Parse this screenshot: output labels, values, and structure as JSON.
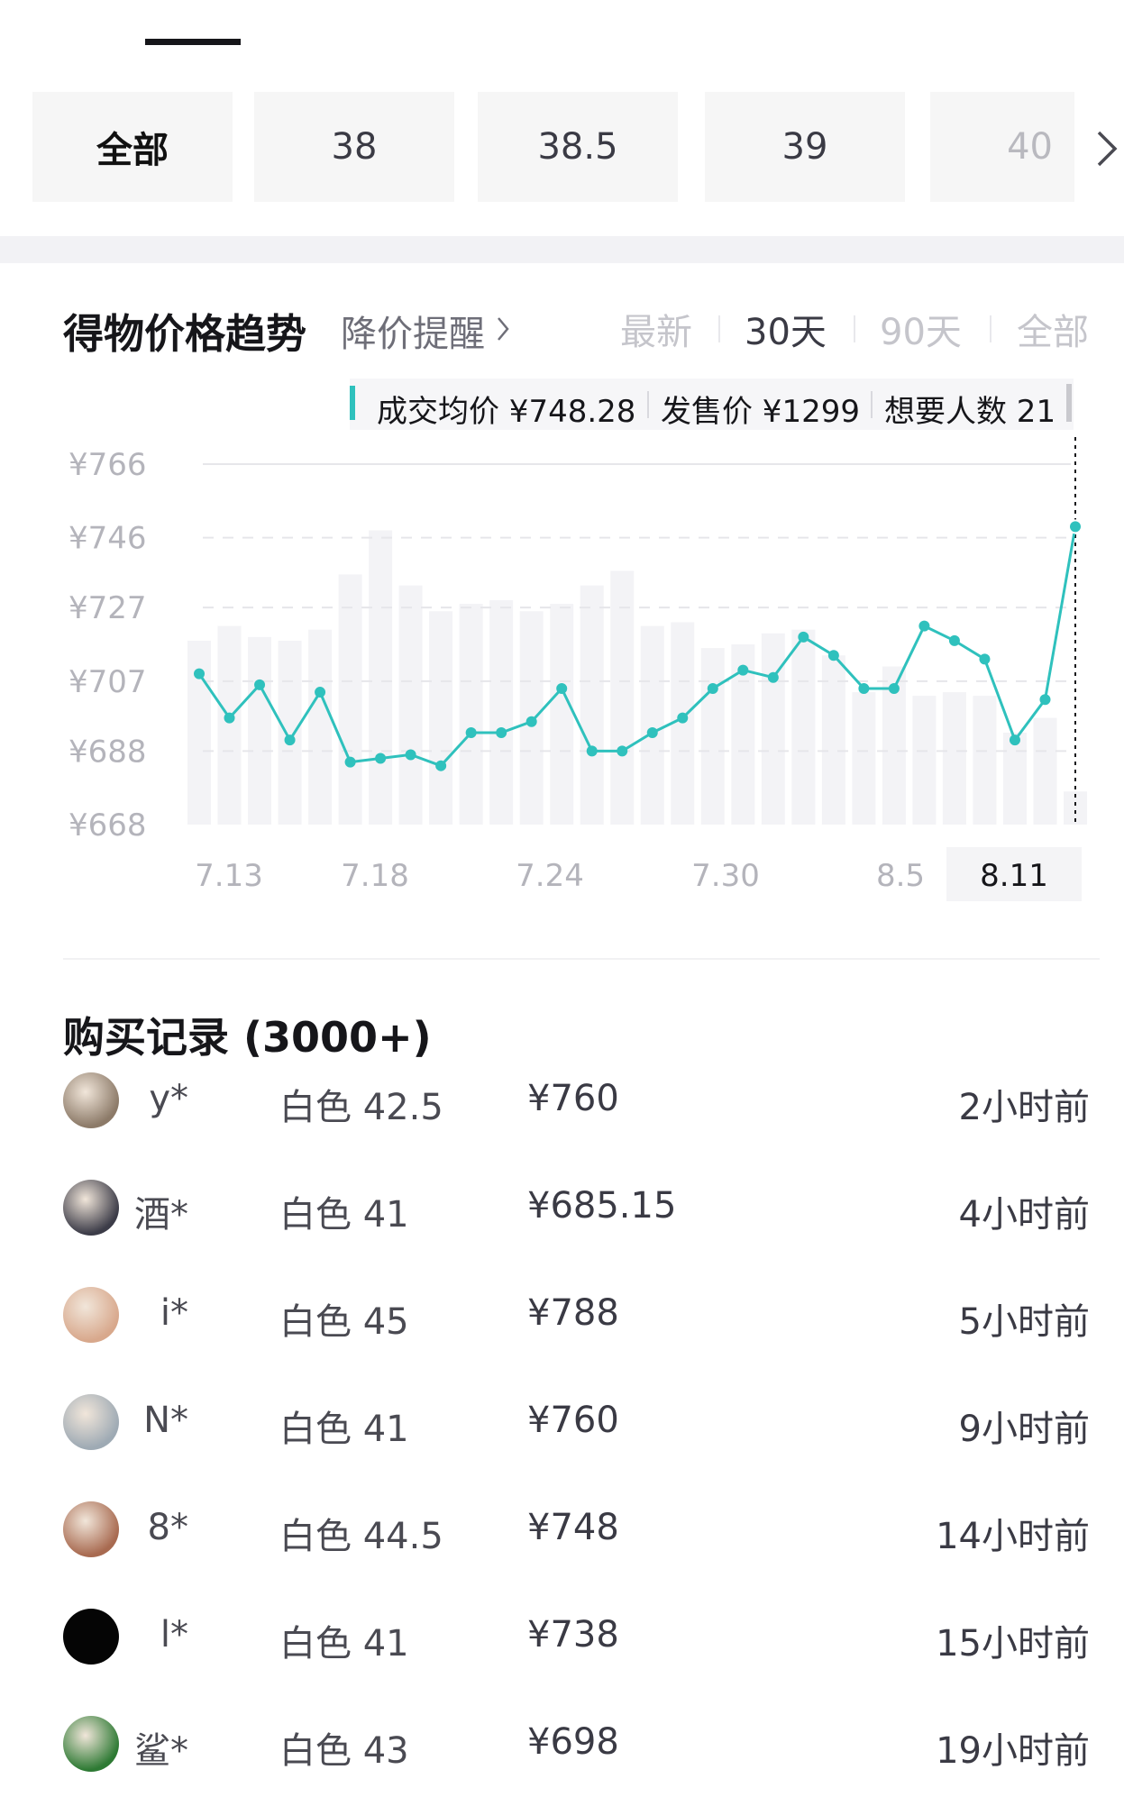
{
  "size_filter": {
    "options": [
      "全部",
      "38",
      "38.5",
      "39",
      "40"
    ],
    "selected": "全部",
    "next_icon": "chevron-right-icon"
  },
  "price_trend": {
    "title": "得物价格趋势",
    "alert_label": "降价提醒",
    "alert_icon": "chevron-right-icon",
    "ranges": [
      "最新",
      "30天",
      "90天",
      "全部"
    ],
    "selected_range": "30天",
    "tooltip": {
      "avg_price": "成交均价 ¥748.28",
      "retail_price": "发售价 ¥1299",
      "wants": "想要人数 21"
    },
    "accent_color": "#2fc1bd"
  },
  "chart_data": {
    "type": "line",
    "y_tick_labels": [
      "¥766",
      "¥746",
      "¥727",
      "¥707",
      "¥688",
      "¥668"
    ],
    "y_ticks": [
      766,
      746,
      727,
      707,
      688,
      668
    ],
    "ylim": [
      668,
      766
    ],
    "x_tick_labels": [
      "7.13",
      "7.18",
      "7.24",
      "7.30",
      "8.5",
      "8.11"
    ],
    "highlighted_x_label": "8.11",
    "grid": true,
    "series": [
      {
        "type": "line",
        "values": [
          709,
          697,
          706,
          691,
          704,
          685,
          686,
          687,
          684,
          693,
          693,
          696,
          705,
          688,
          688,
          693,
          697,
          705,
          710,
          708,
          719,
          714,
          705,
          705,
          722,
          718,
          713,
          691,
          702,
          749
        ]
      },
      {
        "type": "bar",
        "values": [
          718,
          722,
          719,
          718,
          721,
          736,
          748,
          733,
          726,
          728,
          729,
          726,
          728,
          733,
          737,
          722,
          723,
          716,
          717,
          720,
          721,
          714,
          704,
          711,
          703,
          704,
          703,
          693,
          697,
          677
        ]
      }
    ]
  },
  "records": {
    "title": "购买记录 (3000+)",
    "rows": [
      {
        "user": "y*",
        "size": "白色 42.5",
        "price": "¥760",
        "time": "2小时前",
        "avatar": "#8c7a68"
      },
      {
        "user": "酒*",
        "size": "白色 41",
        "price": "¥685.15",
        "time": "4小时前",
        "avatar": "#3c3c48"
      },
      {
        "user": "i*",
        "size": "白色 45",
        "price": "¥788",
        "time": "5小时前",
        "avatar": "#d8a88c"
      },
      {
        "user": "N*",
        "size": "白色 41",
        "price": "¥760",
        "time": "9小时前",
        "avatar": "#9eaab4"
      },
      {
        "user": "8*",
        "size": "白色 44.5",
        "price": "¥748",
        "time": "14小时前",
        "avatar": "#a86a50"
      },
      {
        "user": "l*",
        "size": "白色 41",
        "price": "¥738",
        "time": "15小时前",
        "avatar": "#050505"
      },
      {
        "user": "鲨*",
        "size": "白色 43",
        "price": "¥698",
        "time": "19小时前",
        "avatar": "#2e7a34"
      }
    ]
  }
}
